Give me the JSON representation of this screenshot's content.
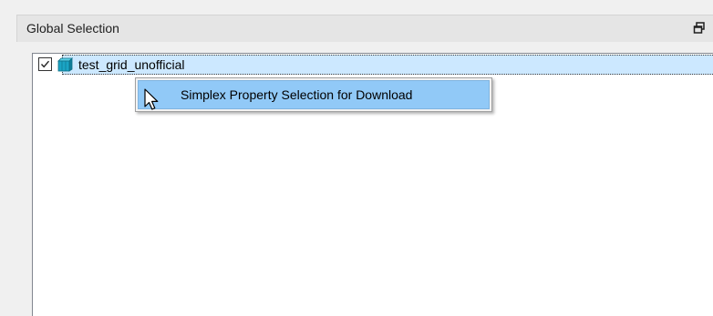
{
  "panel": {
    "title": "Global Selection",
    "close_glyph": "×",
    "restore_icon": "restore-window-icon",
    "close_icon": "close-icon"
  },
  "tree": {
    "nodes": [
      {
        "label": "test_grid_unofficial",
        "checked": true,
        "icon": "grid-cube-icon",
        "icon_color": "#1ba4c4",
        "selected": true
      }
    ]
  },
  "context_menu": {
    "items": [
      {
        "label": "Simplex Property Selection for Download",
        "highlighted": true
      }
    ]
  },
  "colors": {
    "selection_bg": "#cce8ff",
    "menu_highlight": "#91c9f7",
    "panel_bg": "#f0f0f0",
    "header_bg": "#e5e5e5"
  }
}
